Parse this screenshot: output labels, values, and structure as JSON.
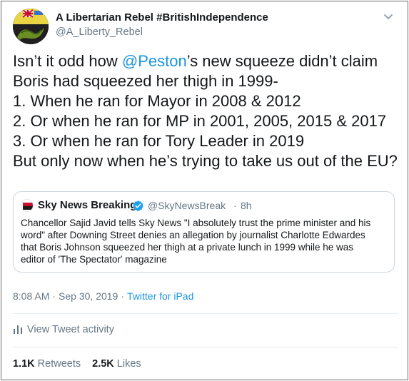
{
  "author": {
    "name": "A Libertarian Rebel #BritishIndependence",
    "handle": "@A_Liberty_Rebel"
  },
  "tweet": {
    "line1_before": "Isn’t it odd how ",
    "mention": "@Peston",
    "line1_after": "’s new squeeze didn’t claim",
    "line2": "Boris had squeezed her thigh in 1999-",
    "line3": "1. When he ran for Mayor in 2008 & 2012",
    "line4": "2. Or when he ran for MP in 2001, 2005, 2015 & 2017",
    "line5": "3. Or when he ran for Tory Leader in 2019",
    "line6": "But only now when he’s trying to take us out of the EU?"
  },
  "quoted": {
    "avatar_text": "sky news",
    "name": "Sky News Breaking",
    "handle": "@SkyNewsBreak",
    "dot": "·",
    "time": "8h",
    "line1": "Chancellor Sajid Javid tells Sky News \"I absolutely trust the prime minister and his",
    "line2": "word\" after Downing Street denies an allegation by journalist Charlotte Edwardes",
    "line3": "that Boris Johnson squeezed her thigh at a private lunch in 1999 while he was",
    "line4": "editor of 'The Spectator' magazine"
  },
  "meta": {
    "time": "8:08 AM",
    "sep1": "·",
    "date": "Sep 30, 2019",
    "sep2": "·",
    "source": "Twitter for iPad"
  },
  "activity": {
    "label": "View Tweet activity",
    "icon": "bar-chart-icon"
  },
  "stats": {
    "retweets_count": "1.1K",
    "retweets_label": "Retweets",
    "likes_count": "2.5K",
    "likes_label": "Likes"
  },
  "colors": {
    "link": "#1b95e0",
    "secondary": "#657786",
    "verified": "#1da1f2",
    "border": "#ccd6dd"
  }
}
